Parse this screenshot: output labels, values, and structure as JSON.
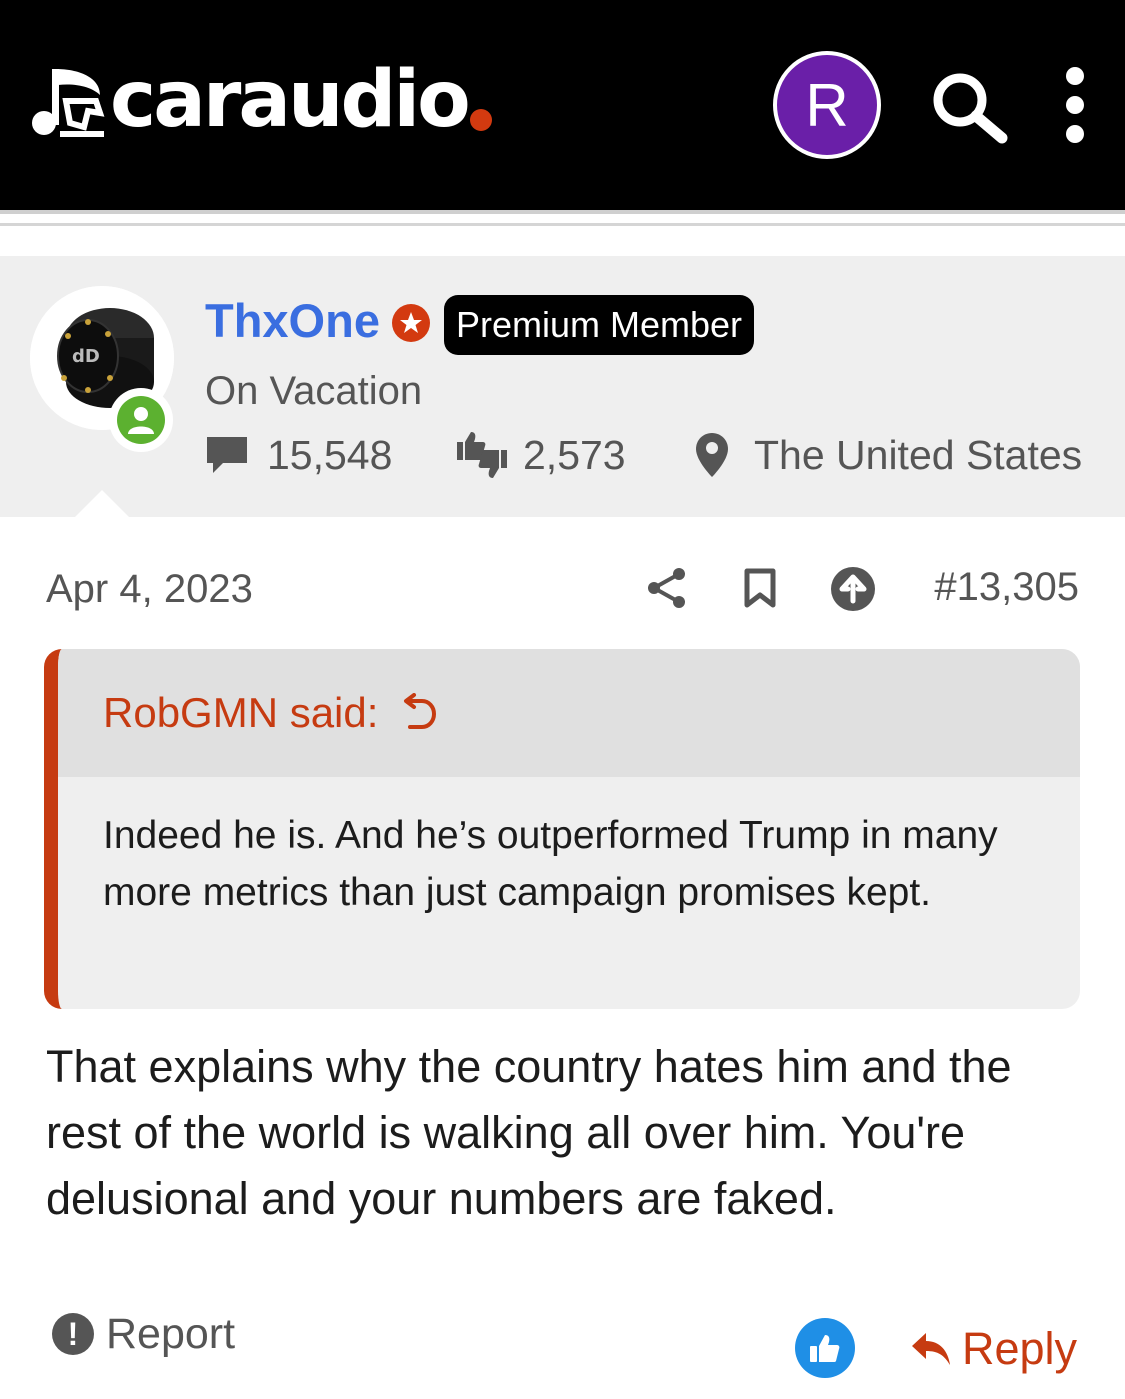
{
  "header": {
    "logo_text": "caraudio",
    "user_initial": "R",
    "icons": [
      "music-note-logo-icon",
      "search-icon",
      "more-vertical-icon"
    ]
  },
  "post": {
    "author": {
      "name": "ThxOne",
      "badge": "Premium Member",
      "title": "On Vacation",
      "messages": "15,548",
      "reactions": "2,573",
      "location": "The United States"
    },
    "date": "Apr 4, 2023",
    "number": "#13,305",
    "quote": {
      "author_label": "RobGMN said:",
      "text": "Indeed he is. And he’s outperformed Trump in many more metrics than just campaign promises kept."
    },
    "body": "That explains why the country hates him and the rest of the world is walking all over him. You're delusional and your numbers are faked.",
    "actions": {
      "report_label": "Report",
      "reply_label": "Reply"
    }
  },
  "colors": {
    "header_bg": "#000000",
    "brand_dot": "#d33a10",
    "avatar_purple": "#6a1fa8",
    "username_blue": "#3a6ee0",
    "quote_accent": "#c63b11",
    "reply_red": "#c63b11",
    "online_green": "#5cb130",
    "like_blue": "#1f8fe6"
  }
}
